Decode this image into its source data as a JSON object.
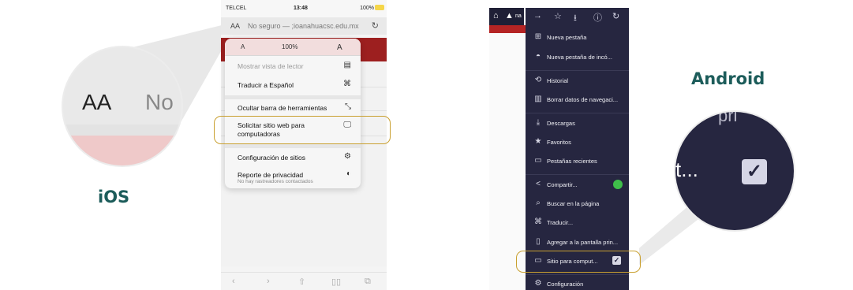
{
  "ios": {
    "platform_label": "iOS",
    "status": {
      "carrier": "TELCEL",
      "time": "13:48",
      "battery": "100%"
    },
    "address_bar": {
      "aa_label": "AA",
      "url": "No seguro — ;ioanahuacsc.edu.mx",
      "reload_icon": "reload-icon"
    },
    "zoom_circle": {
      "aa_text": "AA",
      "no_text": "No"
    },
    "menu": {
      "zoom_small": "A",
      "zoom_value": "100%",
      "zoom_large": "A",
      "items": [
        {
          "label": "Mostrar vista de lector",
          "icon": "reader-icon",
          "disabled": true
        },
        {
          "label": "Traducir a Español",
          "icon": "translate-icon"
        },
        {
          "label": "Ocultar barra de herramientas",
          "icon": "resize-arrows-icon"
        },
        {
          "label": "Solicitar sitio web para",
          "label2": "computadoras",
          "icon": "monitor-icon"
        },
        {
          "label": "Configuración de sitios",
          "icon": "gear-icon"
        },
        {
          "label": "Reporte de privacidad",
          "sublabel": "No hay rastreadores contactados",
          "icon": "privacy-shield-icon"
        }
      ]
    },
    "toolbar": [
      "back-icon",
      "forward-icon",
      "share-icon",
      "bookmarks-icon",
      "tabs-icon"
    ]
  },
  "android": {
    "platform_label": "Android",
    "topbar_url": "na",
    "menu_top_icons": [
      "forward-icon",
      "star-icon",
      "download-icon",
      "info-icon",
      "reload-icon"
    ],
    "items": [
      {
        "label": "Nueva pestaña",
        "icon": "plus-box-icon"
      },
      {
        "label": "Nueva pestaña de incó...",
        "icon": "incognito-icon"
      },
      {
        "label": "Historial",
        "icon": "history-icon"
      },
      {
        "label": "Borrar datos de navegaci...",
        "icon": "trash-icon"
      },
      {
        "label": "Descargas",
        "icon": "downloads-icon"
      },
      {
        "label": "Favoritos",
        "icon": "star-icon"
      },
      {
        "label": "Pestañas recientes",
        "icon": "recent-tabs-icon"
      },
      {
        "label": "Compartir...",
        "icon": "share-icon"
      },
      {
        "label": "Buscar en la página",
        "icon": "find-in-page-icon"
      },
      {
        "label": "Traducir...",
        "icon": "translate-icon"
      },
      {
        "label": "Agregar a la pantalla prin...",
        "icon": "add-home-icon"
      },
      {
        "label": "Sitio para comput...",
        "icon": "monitor-icon",
        "checked": true
      },
      {
        "label": "Configuración",
        "icon": "gear-icon"
      }
    ],
    "zoom_circle": {
      "text": "t...",
      "top_text": "pri"
    }
  },
  "colors": {
    "accent_label": "#1c5c5a",
    "highlight_box": "#c9a030",
    "android_menu_bg": "#262640",
    "ios_page_red": "#9d1f1f"
  }
}
